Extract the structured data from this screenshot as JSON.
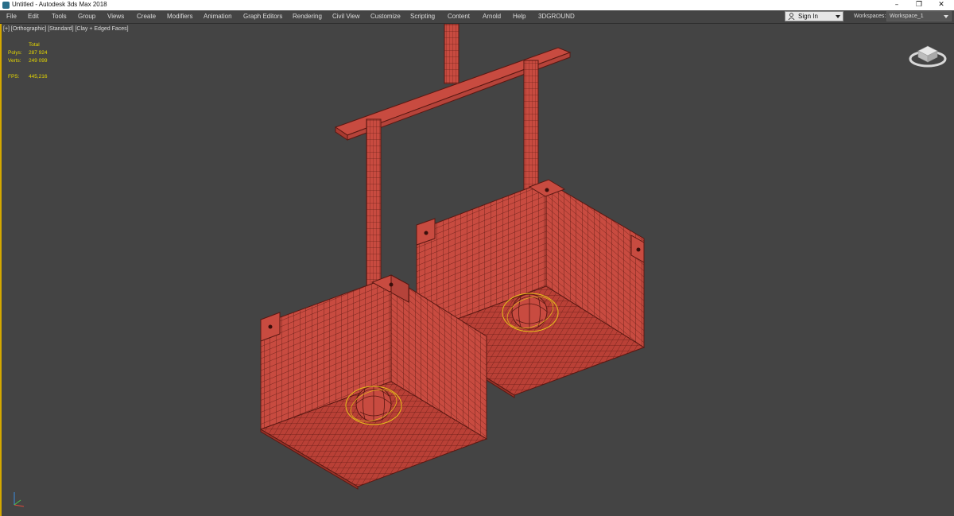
{
  "window": {
    "title": "Untitled - Autodesk 3ds Max 2018",
    "minimize": "–",
    "restore": "❐",
    "close": "✕"
  },
  "menu": [
    "File",
    "Edit",
    "Tools",
    "Group",
    "Views",
    "Create",
    "Modifiers",
    "Animation",
    "Graph Editors",
    "Rendering",
    "Civil View",
    "Customize",
    "Scripting",
    "Content",
    "Arnold",
    "Help",
    "3DGROUND"
  ],
  "account": {
    "sign_in": "Sign In"
  },
  "workspaces": {
    "label": "Workspaces:",
    "value": "Workspace_1"
  },
  "viewport": {
    "label": "[+] [Orthographic] [Standard] [Clay + Edged Faces]",
    "stats": {
      "total_label": "Total",
      "polys_label": "Polys:",
      "polys_value": "287 924",
      "verts_label": "Verts:",
      "verts_value": "249 099",
      "fps_label": "FPS:",
      "fps_value": "445,216"
    }
  },
  "colors": {
    "mesh": "#c84b40",
    "wire": "#5a1812",
    "selection": "#e6c21a",
    "background": "#444444",
    "accent": "#d4a800"
  }
}
